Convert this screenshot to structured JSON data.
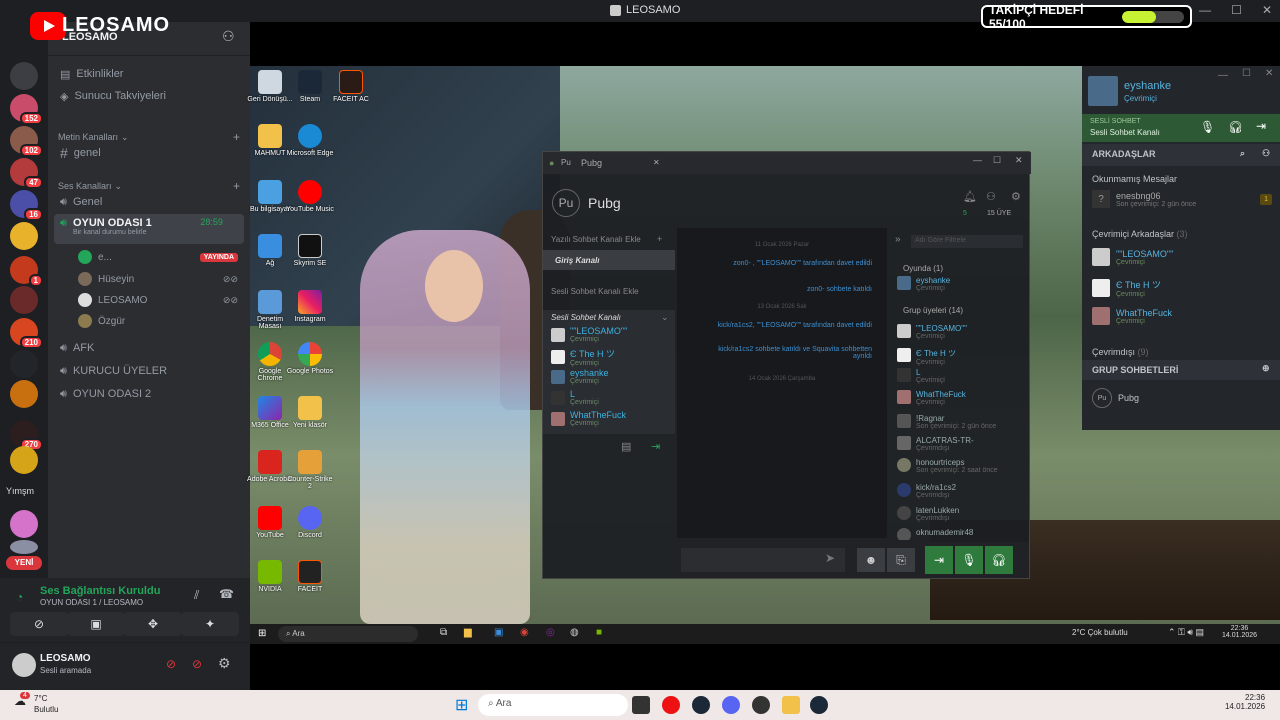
{
  "title_bar": {
    "title": "LEOSAMO"
  },
  "overlay": {
    "channel": "LEOSAMO",
    "goal_label": "TAKİPÇİ HEDEFİ 55/100",
    "goal_progress": 0.55
  },
  "server": {
    "name": "LEOSAMO"
  },
  "servers": [
    {
      "badge": ""
    },
    {
      "badge": "152"
    },
    {
      "badge": "102"
    },
    {
      "badge": "47"
    },
    {
      "badge": "16"
    },
    {
      "badge": ""
    },
    {
      "badge": "1"
    },
    {
      "badge": ""
    },
    {
      "badge": "210"
    },
    {
      "badge": ""
    },
    {
      "badge": ""
    },
    {
      "badge": "270"
    },
    {
      "badge": ""
    },
    {
      "badge": ""
    },
    {
      "badge": ""
    }
  ],
  "rail_labels": {
    "folder": "Yımşm",
    "new": "YENİ"
  },
  "sidebar": {
    "events": "Etkinlikler",
    "boosts": "Sunucu Takviyeleri",
    "text_category": "Metin Kanalları",
    "text_channel": "genel",
    "voice_category": "Ses Kanalları",
    "voice_channels": [
      "Genel",
      "OYUN ODASI 1",
      "AFK",
      "KURUCU ÜYELER",
      "OYUN ODASI 2"
    ],
    "active_timer": "28:59",
    "status_hint": "Bir kanal durumu belirle",
    "live_badge": "YAYINDA",
    "members": [
      "e...",
      "Hüseyin",
      "LEOSAMO",
      "Özgür"
    ]
  },
  "voice_panel": {
    "status": "Ses Bağlantısı Kuruldu",
    "channel": "OYUN ODASI 1 / LEOSAMO"
  },
  "user_panel": {
    "name": "LEOSAMO",
    "status": "Sesli aramada"
  },
  "desktop_icons": [
    {
      "label": "Geri Dönüşü..."
    },
    {
      "label": "Steam"
    },
    {
      "label": "FACEIT AC"
    },
    {
      "label": "MAHMUT"
    },
    {
      "label": "Microsoft Edge"
    },
    {
      "label": "Bu bilgisayar"
    },
    {
      "label": "YouTube Music"
    },
    {
      "label": "Ağ"
    },
    {
      "label": "Skyrim SE"
    },
    {
      "label": "Denetim Masası"
    },
    {
      "label": "Instagram"
    },
    {
      "label": "Google Chrome"
    },
    {
      "label": "Google Photos"
    },
    {
      "label": "M365 Office"
    },
    {
      "label": "Yeni klasör"
    },
    {
      "label": "Adobe Acrobat"
    },
    {
      "label": "Counter-Strike 2"
    },
    {
      "label": "YouTube"
    },
    {
      "label": "Discord"
    },
    {
      "label": "NVIDIA"
    },
    {
      "label": "FACEIT"
    }
  ],
  "pubg": {
    "tab": "Pubg",
    "header": "Pubg",
    "avatar": "Pu",
    "online_count": "5",
    "member_count": "15 ÜYE",
    "text_section": "Yazılı Sohbet Kanalı Ekle",
    "entry_channel": "Giriş Kanalı",
    "voice_section": "Sesli Sohbet Kanalı Ekle",
    "voice_channel": "Sesli Sohbet Kanalı",
    "voice_members": [
      {
        "name": "\"\"LEOSAMO\"\"",
        "status": "Çevrimiçi"
      },
      {
        "name": "Є The H ツ",
        "status": "Çevrimiçi"
      },
      {
        "name": "eyshanke",
        "status": "Çevrimiçi"
      },
      {
        "name": "L",
        "status": "Çevrimiçi"
      },
      {
        "name": "WhatTheFuck",
        "status": "Çevrimiçi"
      }
    ],
    "chat": [
      {
        "type": "date",
        "text": "11 Ocak 2026 Pazar"
      },
      {
        "type": "msg",
        "text": "zon0- , \"\"LEOSAMO\"\" tarafından davet edildi"
      },
      {
        "type": "msg",
        "text": "zon0- sohbete katıldı"
      },
      {
        "type": "date",
        "text": "13 Ocak 2026 Salı"
      },
      {
        "type": "msg",
        "text": "kick/ra1cs2, \"\"LEOSAMO\"\" tarafından davet edildi"
      },
      {
        "type": "msg",
        "text": "kick/ra1cs2 sohbete katıldı ve Squavita sohbetten ayrıldı"
      },
      {
        "type": "date",
        "text": "14 Ocak 2026 Çarşamba"
      }
    ],
    "search_placeholder": "Adı Göre Filtrele",
    "in_game_label": "Oyunda (1)",
    "in_game": [
      {
        "name": "eyshanke",
        "status": "Çevrimiçi"
      }
    ],
    "group_label": "Grup üyeleri (14)",
    "group_members": [
      {
        "name": "\"\"LEOSAMO\"\"",
        "status": "Çevrimiçi"
      },
      {
        "name": "Є The H ツ",
        "status": "Çevrimiçi"
      },
      {
        "name": "L",
        "status": "Çevrimiçi"
      },
      {
        "name": "WhatTheFuck",
        "status": "Çevrimiçi"
      },
      {
        "name": "!Ragnar",
        "status": "Son çevrimiçi: 2 gün önce"
      },
      {
        "name": "ALCATRAS-TR-",
        "status": "Çevrimdışı"
      },
      {
        "name": "honourtriceps",
        "status": "Son çevrimiçi: 2 saat önce"
      },
      {
        "name": "kick/ra1cs2",
        "status": "Çevrimdışı"
      },
      {
        "name": "latenLukken",
        "status": "Çevrimdışı"
      },
      {
        "name": "oknumademir48",
        "status": ""
      }
    ]
  },
  "friends": {
    "user": "eyshanke",
    "user_status": "Çevrimiçi",
    "voice_label": "SESLİ SOHBET",
    "voice_channel": "Sesli Sohbet Kanalı",
    "header": "ARKADAŞLAR",
    "unread_label": "Okunmamış Mesajlar",
    "unread": [
      {
        "name": "enesbng06",
        "status": "Son çevrimiçi: 2 gün önce",
        "count": "1"
      }
    ],
    "online_label": "Çevrimiçi Arkadaşlar",
    "online_count": "(3)",
    "online": [
      {
        "name": "\"\"LEOSAMO\"\"",
        "status": "Çevrimiçi"
      },
      {
        "name": "Є The H ツ",
        "status": "Çevrimiçi"
      },
      {
        "name": "WhatTheFuck",
        "status": "Çevrimiçi"
      }
    ],
    "offline_label": "Çevrimdışı",
    "offline_count": "(9)",
    "groups_label": "GRUP SOHBETLERİ",
    "group": "Pubg"
  },
  "inner_taskbar": {
    "search": "Ara",
    "weather": "2°C Çok bulutlu",
    "time": "22:36",
    "date": "14.01.2026"
  },
  "taskbar": {
    "temp": "7°C",
    "weather": "Bulutlu",
    "weather_badge": "4",
    "search": "Ara",
    "time": "22:36",
    "date": "14.01.2026"
  },
  "colors": {
    "accent_green": "#23a55a",
    "discord_bg": "#2b2d31",
    "live_red": "#da373c",
    "steam_blue": "#56b4e0"
  }
}
